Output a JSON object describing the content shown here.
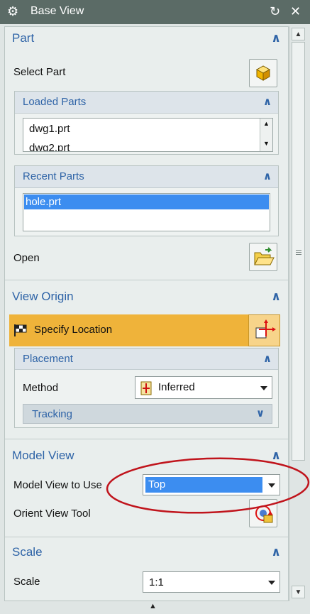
{
  "window": {
    "title": "Base View",
    "title_icon": "gear-icon",
    "reset_icon": "reset-icon",
    "close_icon": "close-icon"
  },
  "part": {
    "title": "Part",
    "select_part_label": "Select Part",
    "loaded_parts": {
      "title": "Loaded Parts",
      "items": [
        "dwg1.prt",
        "dwg2.prt"
      ]
    },
    "recent_parts": {
      "title": "Recent Parts",
      "items": [
        "hole.prt"
      ],
      "selected": "hole.prt"
    },
    "open_label": "Open"
  },
  "view_origin": {
    "title": "View Origin",
    "specify_location_label": "Specify Location",
    "placement": {
      "title": "Placement",
      "method_label": "Method",
      "method_value": "Inferred",
      "tracking_label": "Tracking"
    }
  },
  "model_view": {
    "title": "Model View",
    "model_view_to_use_label": "Model View to Use",
    "model_view_value": "Top",
    "orient_view_tool_label": "Orient View Tool"
  },
  "scale": {
    "title": "Scale",
    "scale_label": "Scale",
    "scale_value": "1:1"
  },
  "colors": {
    "accent": "#2f64a7",
    "highlight": "#efb33a",
    "selection": "#3c8df0",
    "annotation_circle": "#c0141c"
  }
}
